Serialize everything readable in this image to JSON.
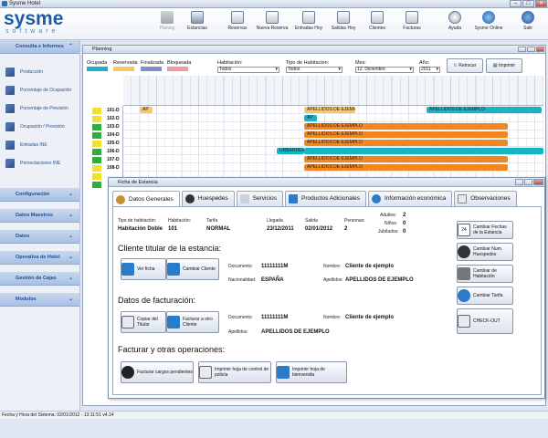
{
  "window": {
    "title": "Sysme Hotel"
  },
  "logo": {
    "line1": "sysme",
    "line2": "software"
  },
  "toolbar": {
    "items": [
      {
        "label": "Planing",
        "icon": "planning-icon",
        "disabled": true
      },
      {
        "label": "Estancias",
        "icon": "stays-icon"
      },
      {
        "label": "Reservas",
        "icon": "reservations-icon"
      },
      {
        "label": "Nueva Reserva",
        "icon": "new-reservation-icon"
      },
      {
        "label": "Entradas Hoy",
        "icon": "arrivals-icon"
      },
      {
        "label": "Salidas Hoy",
        "icon": "departures-icon"
      },
      {
        "label": "Clientes",
        "icon": "clients-icon"
      },
      {
        "label": "Facturas",
        "icon": "invoices-icon"
      },
      {
        "label": "Ayuda",
        "icon": "help-icon"
      },
      {
        "label": "Sysme Online",
        "icon": "globe-icon"
      },
      {
        "label": "Salir",
        "icon": "power-icon"
      }
    ]
  },
  "sidebar": {
    "group1": "Consulta e Informes",
    "items": [
      "Producción",
      "Porcentaje de Ocupación",
      "Porcentaje de Previsión",
      "Ocupación / Previsión",
      "Entradas INE",
      "Pernoctaciones INE"
    ],
    "groups": [
      "Configuración",
      "Datos Maestros",
      "Datos",
      "Operativa de Hotel",
      "Gestión de Cajas",
      "Modulos"
    ]
  },
  "planning": {
    "title": "Planning",
    "legend": [
      {
        "label": "Ocupada",
        "color": "#17b4c6"
      },
      {
        "label": "Reservada",
        "color": "#f8c764"
      },
      {
        "label": "Finalizada",
        "color": "#7c8fc6"
      },
      {
        "label": "Bloqueada",
        "color": "#f29a9a"
      }
    ],
    "filters": {
      "habitacion_label": "Habitación:",
      "habitacion_value": "Todos",
      "tipo_label": "Tipo de Habitacion:",
      "tipo_value": "Todos",
      "mes_label": "Mes:",
      "mes_value": "12. Diciembre",
      "ano_label": "Año:",
      "ano_value": "2011"
    },
    "btn_retrocar": "Retrocar",
    "btn_imprimir": "Imprimir",
    "rooms": [
      {
        "num": "101-D",
        "color": "#f2df2f"
      },
      {
        "num": "102-D",
        "color": "#f2df2f"
      },
      {
        "num": "103-D",
        "color": "#2fae3b"
      },
      {
        "num": "104-D",
        "color": "#2fae3b"
      },
      {
        "num": "105-D",
        "color": "#f2df2f"
      },
      {
        "num": "106-D",
        "color": "#2fae3b"
      },
      {
        "num": "107-D",
        "color": "#2fae3b"
      },
      {
        "num": "108-D",
        "color": "#f2df2f"
      }
    ],
    "bookings": {
      "b1": "AP",
      "b2": "APELLIDOS DE EJEMPLO",
      "b3": "APELLIDOS DE EJEMPLO",
      "b4": "AP",
      "b5": "APELLIDOS DE EJEMPLO",
      "b6": "APELLIDOS DE EJEMPLO",
      "b7": "APELLIDOS DE EJEMPLO",
      "b8": "APELLIDOS DE EJEMPLO",
      "b9": "URBANDER",
      "b10": "APELLIDOS DE EJEMPLO",
      "b11": "APELLIDOS DE EJEMPLO"
    }
  },
  "ficha": {
    "title": "Ficha de Estancia",
    "tabs": [
      "Datos Generales",
      "Huespedes",
      "Servicios",
      "Productos Adicionales",
      "Información económica",
      "Observaciones"
    ],
    "tipo_hab_label": "Tipo de habitación:",
    "tipo_hab_value": "Habitación Doble",
    "hab_label": "Habitación:",
    "hab_value": "101",
    "tarifa_label": "Tarifa",
    "tarifa_value": "NORMAL",
    "llegada_label": "Llegada",
    "llegada_value": "23/12/2011",
    "salida_label": "Salida",
    "salida_value": "02/01/2012",
    "personas_label": "Personas:",
    "personas_value": "2",
    "adultos_label": "Adultos:",
    "adultos_value": "2",
    "ninos_label": "Niños:",
    "ninos_value": "0",
    "jubilados_label": "Jubilados:",
    "jubilados_value": "0",
    "titular_heading": "Cliente titular de la estancia:",
    "doc_label": "Documento:",
    "doc_value": "11111111M",
    "nombre_label": "Nombre:",
    "nombre_value": "Cliente de ejemplo",
    "nac_label": "Nacionalidad:",
    "nac_value": "ESPAÑA",
    "apell_label": "Apellidos:",
    "apell_value": "APELLIDOS DE EJEMPLO",
    "btn_ver_ficha": "Ver ficha",
    "btn_cambiar_cliente": "Cambiar Cliente",
    "fact_heading": "Datos de facturación:",
    "f_doc_label": "Documento:",
    "f_doc_value": "11111111M",
    "f_nombre_label": "Nombre:",
    "f_nombre_value": "Cliente de ejemplo",
    "f_apell_label": "Apellidos:",
    "f_apell_value": "APELLIDOS DE EJEMPLO",
    "btn_copiar_titular": "Copiar del Titular",
    "btn_facturar_otro": "Facturar a otro Cliente",
    "ops_heading": "Facturar y otras operaciones:",
    "btn_facturar_cargos": "Facturar cargos pendientes",
    "btn_imprimir_hoja": "Imprimir hoja de control de policía",
    "btn_imprimir_bienvenida": "Imprimir hoja de bienvenida",
    "side_buttons": [
      "Cambiar Fechas de la Estancia",
      "Cambiar Num. Huespedes",
      "Cambiar de Habitación",
      "Cambiar Tarifa",
      "CHECK-OUT"
    ],
    "side_date_day": "24"
  },
  "status": {
    "text": "Fecha y Hora del Sistema: 02/01/2012 - 13:11:51 v4.14"
  }
}
